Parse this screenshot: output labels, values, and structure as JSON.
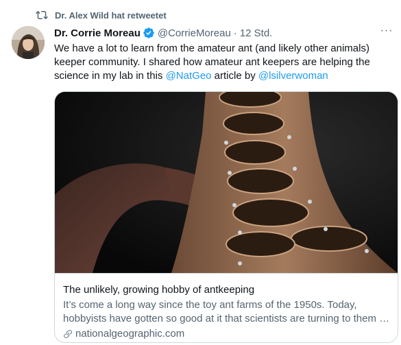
{
  "retweet_banner": {
    "icon": "retweet-icon",
    "text": "Dr. Alex Wild hat retweetet"
  },
  "tweet": {
    "author_name": "Dr. Corrie Moreau",
    "verified_icon": "verified-badge-icon",
    "handle": "@CorrieMoreau",
    "separator": "·",
    "time": "12 Std.",
    "more_icon": "more-icon",
    "more_glyph": "···",
    "text": {
      "part1": "We have a lot to learn from the amateur ant (and likely other animals) keeper community. I shared how amateur ant keepers are helping the science in my lab in this ",
      "mention1": "@NatGeo",
      "part2": " article by ",
      "mention2": "@lsilverwoman"
    }
  },
  "card": {
    "title": "The unlikely, growing hobby of antkeeping",
    "description": "It’s come a long way since the toy ant farms of the 1950s. Today, hobbyists have gotten so good at it that scientists are turning to them …",
    "domain": "nationalgeographic.com",
    "link_icon": "link-icon"
  },
  "colors": {
    "accent": "#1d9bf0",
    "secondary_text": "#536471",
    "border": "#cfd9de"
  }
}
